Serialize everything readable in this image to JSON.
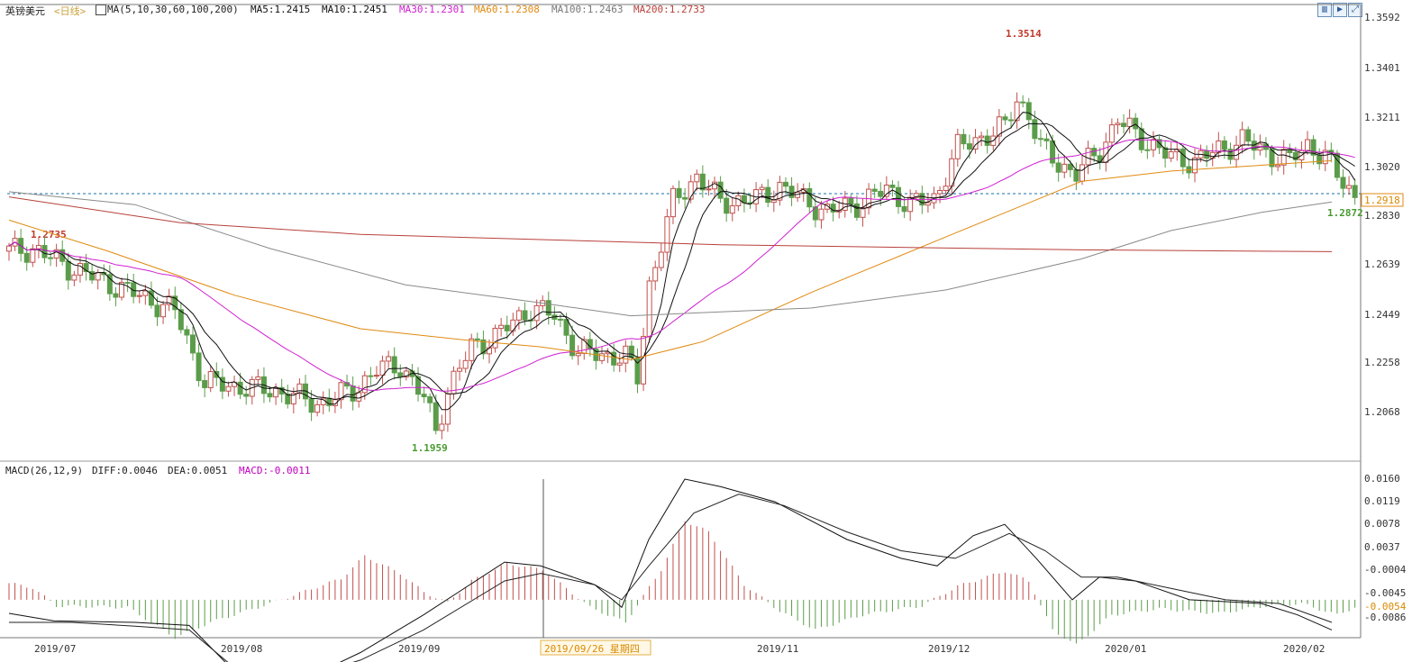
{
  "header": {
    "symbol": "英镑美元",
    "period": "<日线>",
    "ma_label": "MA(5,10,30,60,100,200)",
    "ma5": "MA5:1.2415",
    "ma10": "MA10:1.2451",
    "ma30": "MA30:1.2301",
    "ma60": "MA60:1.2308",
    "ma100": "MA100:1.2463",
    "ma200": "MA200:1.2733"
  },
  "colors": {
    "up": "#c0504d",
    "down": "#5b9c4a",
    "ma5": "#111111",
    "ma10": "#111111",
    "ma30": "#d020d0",
    "ma60": "#e08a10",
    "ma100": "#8a8a8a",
    "ma200": "#b8403a",
    "label_up": "#c0392b",
    "label_down": "#4a9a30",
    "macd_label": "#c000c0",
    "cursor_date": "#d98a00",
    "hline": "#1a6fa8"
  },
  "controls": {
    "icon1": "chart-icon",
    "icon2": "arrow-icon",
    "icon3": "expand-icon"
  },
  "macd_header": {
    "label": "MACD(26,12,9)",
    "diff": "DIFF:0.0046",
    "dea": "DEA:0.0051",
    "macd": "MACD:-0.0011"
  },
  "chart_data": [
    {
      "type": "candlestick",
      "title": "英镑美元<日线>",
      "y_ticks": [
        "1.3592",
        "1.3401",
        "1.3211",
        "1.3020",
        "1.2830",
        "1.2639",
        "1.2449",
        "1.2258",
        "1.2068"
      ],
      "ylim": [
        1.1865,
        1.3602
      ],
      "x_ticks": [
        "2019/07",
        "2019/08",
        "2019/09",
        "2019/11",
        "2019/12",
        "2020/01",
        "2020/02"
      ],
      "annotations": {
        "high": "1.3514",
        "low": "1.1959",
        "start_high": "1.2735",
        "last_low": "1.2872"
      },
      "current_price": "1.2918",
      "current_value": 1.2918,
      "cursor_date": "2019/09/26 星期四",
      "grid": false
    },
    {
      "type": "macd",
      "y_ticks": [
        "0.0160",
        "0.0119",
        "0.0078",
        "0.0037",
        "-0.0004",
        "-0.0045",
        "-0.0086"
      ],
      "ylim": [
        -0.0111,
        0.0165
      ],
      "current_label": "-0.0054",
      "series": [
        {
          "name": "DIFF",
          "value": 0.0046
        },
        {
          "name": "DEA",
          "value": 0.0051
        },
        {
          "name": "MACD",
          "value": -0.0011
        }
      ]
    }
  ]
}
